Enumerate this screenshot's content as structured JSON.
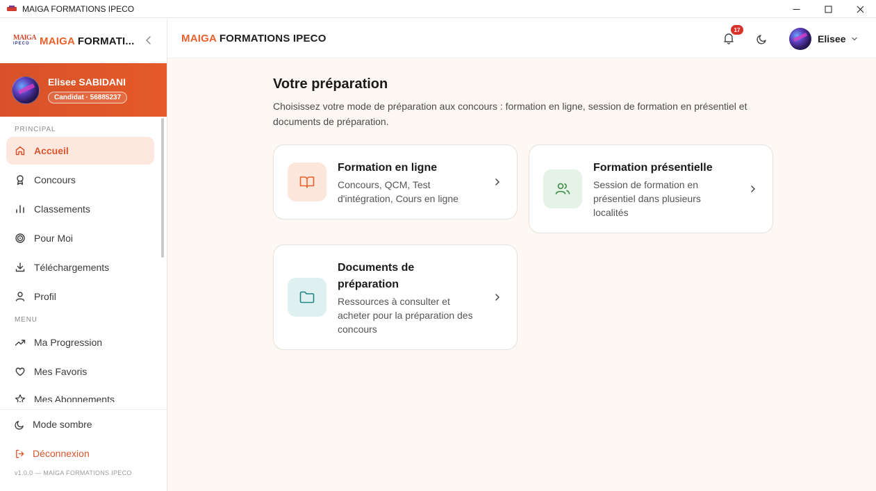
{
  "window": {
    "title": "MAIGA FORMATIONS IPECO"
  },
  "sidebar": {
    "brand_accent": "MAIGA",
    "brand_rest": " FORMATI...",
    "logo_line1": "MAIGA",
    "logo_line2": "IPECO",
    "user": {
      "name": "Elisee SABIDANI",
      "badge": "Candidat · 56885237"
    },
    "sections": {
      "principal": "PRINCIPAL",
      "menu": "MENU"
    },
    "principal_items": [
      {
        "label": "Accueil",
        "icon": "home-icon",
        "active": true
      },
      {
        "label": "Concours",
        "icon": "award-icon"
      },
      {
        "label": "Classements",
        "icon": "bar-chart-icon"
      },
      {
        "label": "Pour Moi",
        "icon": "target-icon"
      },
      {
        "label": "Téléchargements",
        "icon": "download-icon"
      },
      {
        "label": "Profil",
        "icon": "user-icon"
      }
    ],
    "menu_items": [
      {
        "label": "Ma Progression",
        "icon": "trending-up-icon"
      },
      {
        "label": "Mes Favoris",
        "icon": "heart-icon"
      },
      {
        "label": "Mes Abonnements",
        "icon": "star-icon"
      }
    ],
    "footer": {
      "dark_mode": "Mode sombre",
      "logout": "Déconnexion",
      "version": "v1.0.0 — MAIGA FORMATIONS IPECO"
    }
  },
  "header": {
    "title_accent": "MAIGA",
    "title_rest": " FORMATIONS IPECO",
    "notification_count": "17",
    "username": "Elisee"
  },
  "main": {
    "title": "Votre préparation",
    "description": "Choisissez votre mode de préparation aux concours : formation en ligne, session de formation en présentiel et documents de préparation.",
    "cards": [
      {
        "title": "Formation en ligne",
        "description": "Concours, QCM, Test d'intégration, Cours en ligne",
        "icon": "book-open-icon",
        "color": "#e8612c"
      },
      {
        "title": "Formation présentielle",
        "description": "Session de formation en présentiel dans plusieurs localités",
        "icon": "users-icon",
        "color": "#3a8a45"
      },
      {
        "title": "Documents de préparation",
        "description": "Ressources à consulter et acheter pour la préparation des concours",
        "icon": "folder-icon",
        "color": "#1f8585"
      }
    ]
  },
  "colors": {
    "accent": "#e8612c",
    "sidebar_card": "#de5528",
    "active_bg": "#fde8e0",
    "main_bg": "#fdf8f3",
    "badge": "#d8322a"
  }
}
